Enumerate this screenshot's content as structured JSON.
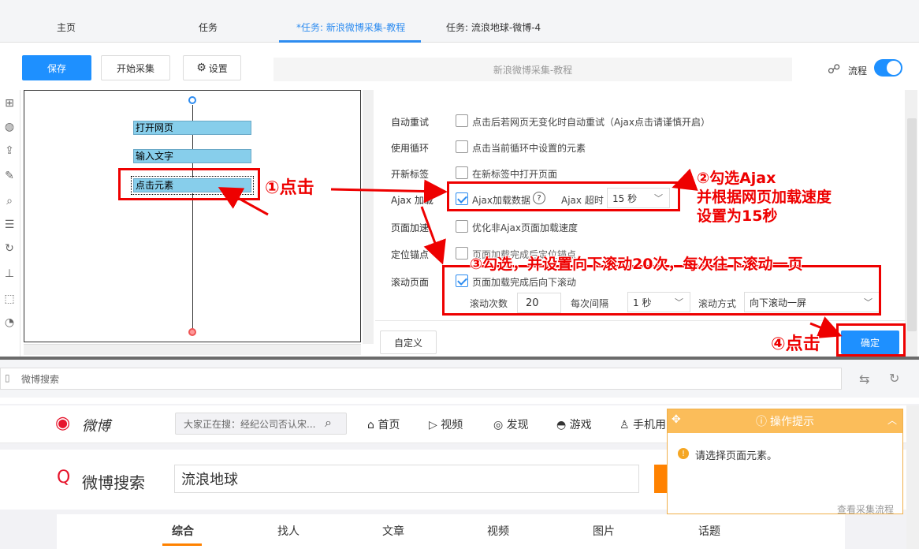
{
  "tabs": [
    {
      "label": "主页"
    },
    {
      "label": "任务"
    },
    {
      "label": "*任务: 新浪微博采集-教程"
    },
    {
      "label": "任务: 流浪地球-微博-4"
    }
  ],
  "toolbar": {
    "save_label": "保存",
    "start_label": "开始采集",
    "settings_label": "设置",
    "task_title": "新浪微博采集-教程",
    "flow_label": "流程"
  },
  "flow": {
    "nodes": [
      "打开网页",
      "输入文字",
      "点击元素"
    ]
  },
  "settings": {
    "rows": [
      {
        "label": "自动重试",
        "text": "点击后若网页无变化时自动重试（Ajax点击请谨慎开启）",
        "checked": false
      },
      {
        "label": "使用循环",
        "text": "点击当前循环中设置的元素",
        "checked": false
      },
      {
        "label": "开新标签",
        "text": "在新标签中打开页面",
        "checked": false
      },
      {
        "label": "Ajax 加载",
        "text": "Ajax加载数据",
        "checked": true
      },
      {
        "label": "页面加速",
        "text": "优化非Ajax页面加载速度",
        "checked": false
      },
      {
        "label": "定位锚点",
        "text": "页面加载完成后定位锚点",
        "checked": false
      },
      {
        "label": "滚动页面",
        "text": "页面加载完成后向下滚动",
        "checked": true
      }
    ],
    "ajax_timeout_label": "Ajax 超时",
    "ajax_timeout_value": "15 秒",
    "scroll_count_label": "滚动次数",
    "scroll_count_value": "20",
    "interval_label": "每次间隔",
    "interval_value": "1 秒",
    "scroll_mode_label": "滚动方式",
    "scroll_mode_value": "向下滚动一屏",
    "custom_label": "自定义",
    "confirm_label": "确定"
  },
  "annotations": {
    "a1": "①点击",
    "a2_line1": "②勾选Ajax",
    "a2_line2": "并根据网页加载速度",
    "a2_line3": "设置为15秒",
    "a3": "③勾选，并设置向下滚动20次，每次往下滚动一页",
    "a4": "④点击"
  },
  "browser": {
    "address": "微博搜索"
  },
  "weibo": {
    "logo": "微博",
    "search_placeholder": "大家正在搜：经纪公司否认宋...",
    "nav": [
      "首页",
      "视频",
      "发现",
      "游戏",
      "手机用"
    ],
    "search_logo": "微博搜索",
    "query": "流浪地球",
    "result_tabs": [
      "综合",
      "找人",
      "文章",
      "视频",
      "图片",
      "话题"
    ]
  },
  "tip": {
    "title": "操作提示",
    "message": "请选择页面元素。",
    "link": "查看采集流程"
  },
  "colors": {
    "accent": "#1e90ff",
    "annotation": "#e00000",
    "node": "#87ceeb",
    "tip_header": "#fbbd5a",
    "weibo_orange": "#ff8200"
  }
}
